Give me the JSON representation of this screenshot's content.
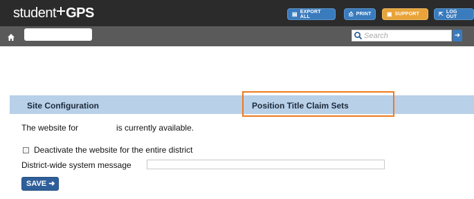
{
  "header": {
    "logo_text_left": "student",
    "logo_text_right": "GPS",
    "buttons": {
      "export_all": "EXPORT ALL",
      "print": "PRINT",
      "support": "SUPPORT",
      "log_out": "LOG OUT"
    }
  },
  "nav": {
    "search_placeholder": "Search"
  },
  "tabs": {
    "site_configuration": "Site Configuration",
    "position_title_claim_sets": "Position Title Claim Sets"
  },
  "content": {
    "status_prefix": "The website for",
    "status_suffix": "is currently available.",
    "deactivate_label": "Deactivate the website for the entire district",
    "message_label": "District-wide system message",
    "save_label": "SAVE"
  },
  "colors": {
    "header_bg": "#2b2b2b",
    "nav_bg": "#5a5a5a",
    "tab_bg": "#b8d0e8",
    "highlight": "#ee7a1e",
    "button_blue": "#3a7bbd",
    "support_orange": "#e8a33a"
  }
}
